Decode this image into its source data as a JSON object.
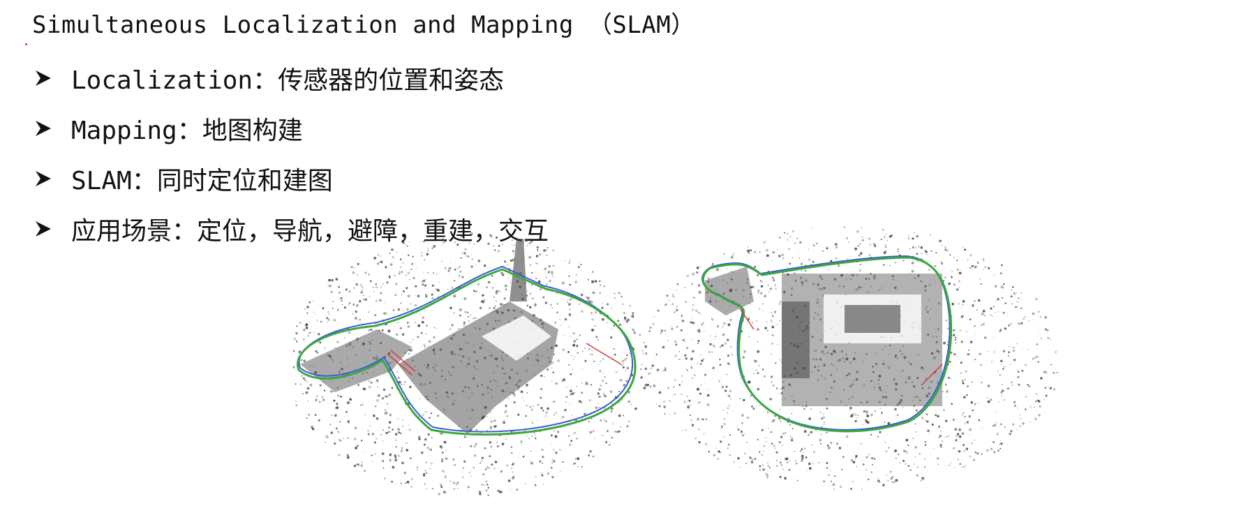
{
  "title": "Simultaneous Localization and Mapping （SLAM）",
  "bullets": [
    {
      "icon": "arrowhead-bullet-icon",
      "label": "Localization：传感器的位置和姿态"
    },
    {
      "icon": "arrowhead-bullet-icon",
      "label": "Mapping：地图构建"
    },
    {
      "icon": "arrowhead-bullet-icon",
      "label": "SLAM：同时定位和建图"
    },
    {
      "icon": "arrowhead-bullet-icon",
      "label": "应用场景：定位，导航，避障，重建，交互"
    }
  ],
  "figure": {
    "panels": [
      "slam-map-perspective-view",
      "slam-map-top-view"
    ],
    "colors": {
      "point_cloud": "#3a3a3a",
      "trajectory": "#3aa83a",
      "trajectory_blue": "#3a5ad8",
      "loop_closure": "#d83a3a"
    }
  }
}
